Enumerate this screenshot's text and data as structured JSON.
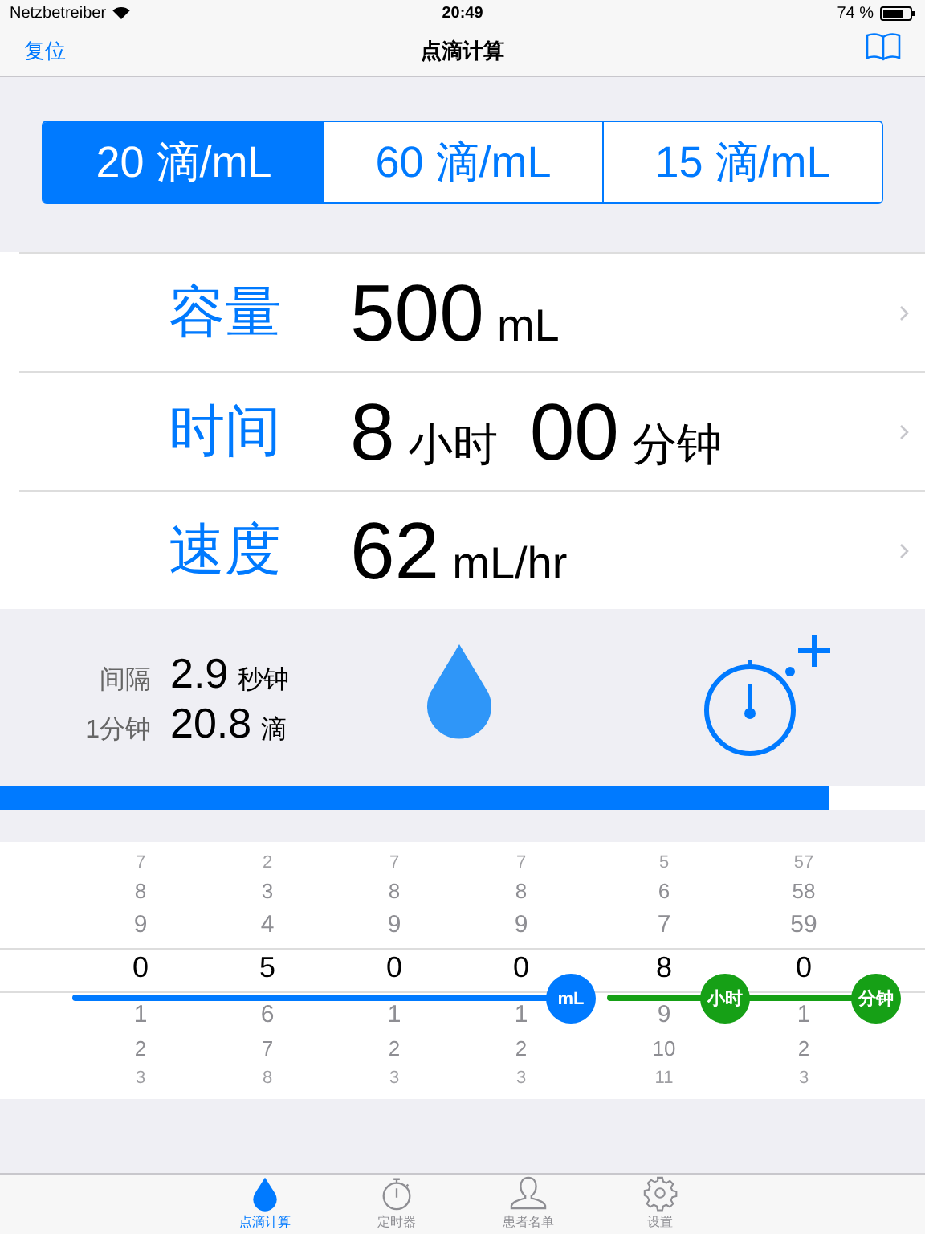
{
  "status_bar": {
    "carrier": "Netzbetreiber",
    "time": "20:49",
    "battery": "74 %"
  },
  "nav": {
    "left_button": "复位",
    "title": "点滴计算"
  },
  "segments": [
    {
      "label": "20 滴/mL",
      "selected": true
    },
    {
      "label": "60 滴/mL",
      "selected": false
    },
    {
      "label": "15 滴/mL",
      "selected": false
    }
  ],
  "rows": [
    {
      "label": "容量",
      "value": [
        {
          "kind": "number",
          "text": "500"
        },
        {
          "kind": "unit",
          "text": "mL"
        }
      ]
    },
    {
      "label": "时间",
      "value": [
        {
          "kind": "number",
          "text": "8"
        },
        {
          "kind": "unit",
          "text": "小时"
        },
        {
          "kind": "number",
          "text": "00"
        },
        {
          "kind": "unit",
          "text": "分钟"
        }
      ]
    },
    {
      "label": "速度",
      "value": [
        {
          "kind": "number",
          "text": "62"
        },
        {
          "kind": "unit",
          "text": "mL/hr"
        }
      ]
    }
  ],
  "info": [
    {
      "label": "间隔",
      "value": "2.9",
      "unit": "秒钟"
    },
    {
      "label": "1分钟",
      "value": "20.8",
      "unit": "滴"
    }
  ],
  "progress": {
    "level": 0.895
  },
  "picker": {
    "groups": [
      {
        "color": "#007aff",
        "badges": [
          "mL"
        ],
        "columns": [
          {
            "items": [
              {
                "text": "7",
                "selected": false
              },
              {
                "text": "8",
                "selected": false
              },
              {
                "text": "9",
                "selected": false
              },
              {
                "text": "0",
                "selected": true
              },
              {
                "text": "1",
                "selected": false
              },
              {
                "text": "2",
                "selected": false
              },
              {
                "text": "3",
                "selected": false
              }
            ]
          },
          {
            "items": [
              {
                "text": "2",
                "selected": false
              },
              {
                "text": "3",
                "selected": false
              },
              {
                "text": "4",
                "selected": false
              },
              {
                "text": "5",
                "selected": true
              },
              {
                "text": "6",
                "selected": false
              },
              {
                "text": "7",
                "selected": false
              },
              {
                "text": "8",
                "selected": false
              }
            ]
          },
          {
            "items": [
              {
                "text": "7",
                "selected": false
              },
              {
                "text": "8",
                "selected": false
              },
              {
                "text": "9",
                "selected": false
              },
              {
                "text": "0",
                "selected": true
              },
              {
                "text": "1",
                "selected": false
              },
              {
                "text": "2",
                "selected": false
              },
              {
                "text": "3",
                "selected": false
              }
            ]
          },
          {
            "items": [
              {
                "text": "7",
                "selected": false
              },
              {
                "text": "8",
                "selected": false
              },
              {
                "text": "9",
                "selected": false
              },
              {
                "text": "0",
                "selected": true
              },
              {
                "text": "1",
                "selected": false
              },
              {
                "text": "2",
                "selected": false
              },
              {
                "text": "3",
                "selected": false
              }
            ]
          }
        ]
      },
      {
        "color": "#16a016",
        "badges": [
          "小时",
          "分钟"
        ],
        "columns": [
          {
            "items": [
              {
                "text": "5",
                "selected": false
              },
              {
                "text": "6",
                "selected": false
              },
              {
                "text": "7",
                "selected": false
              },
              {
                "text": "8",
                "selected": true
              },
              {
                "text": "9",
                "selected": false
              },
              {
                "text": "10",
                "selected": false
              },
              {
                "text": "11",
                "selected": false
              }
            ]
          },
          {
            "items": [
              {
                "text": "57",
                "selected": false
              },
              {
                "text": "58",
                "selected": false
              },
              {
                "text": "59",
                "selected": false
              },
              {
                "text": "0",
                "selected": true
              },
              {
                "text": "1",
                "selected": false
              },
              {
                "text": "2",
                "selected": false
              },
              {
                "text": "3",
                "selected": false
              }
            ]
          }
        ]
      }
    ]
  },
  "tab_bar": [
    {
      "label": "点滴计算",
      "selected": true
    },
    {
      "label": "定时器",
      "selected": false
    },
    {
      "label": "患者名单",
      "selected": false
    },
    {
      "label": "设置",
      "selected": false
    }
  ]
}
